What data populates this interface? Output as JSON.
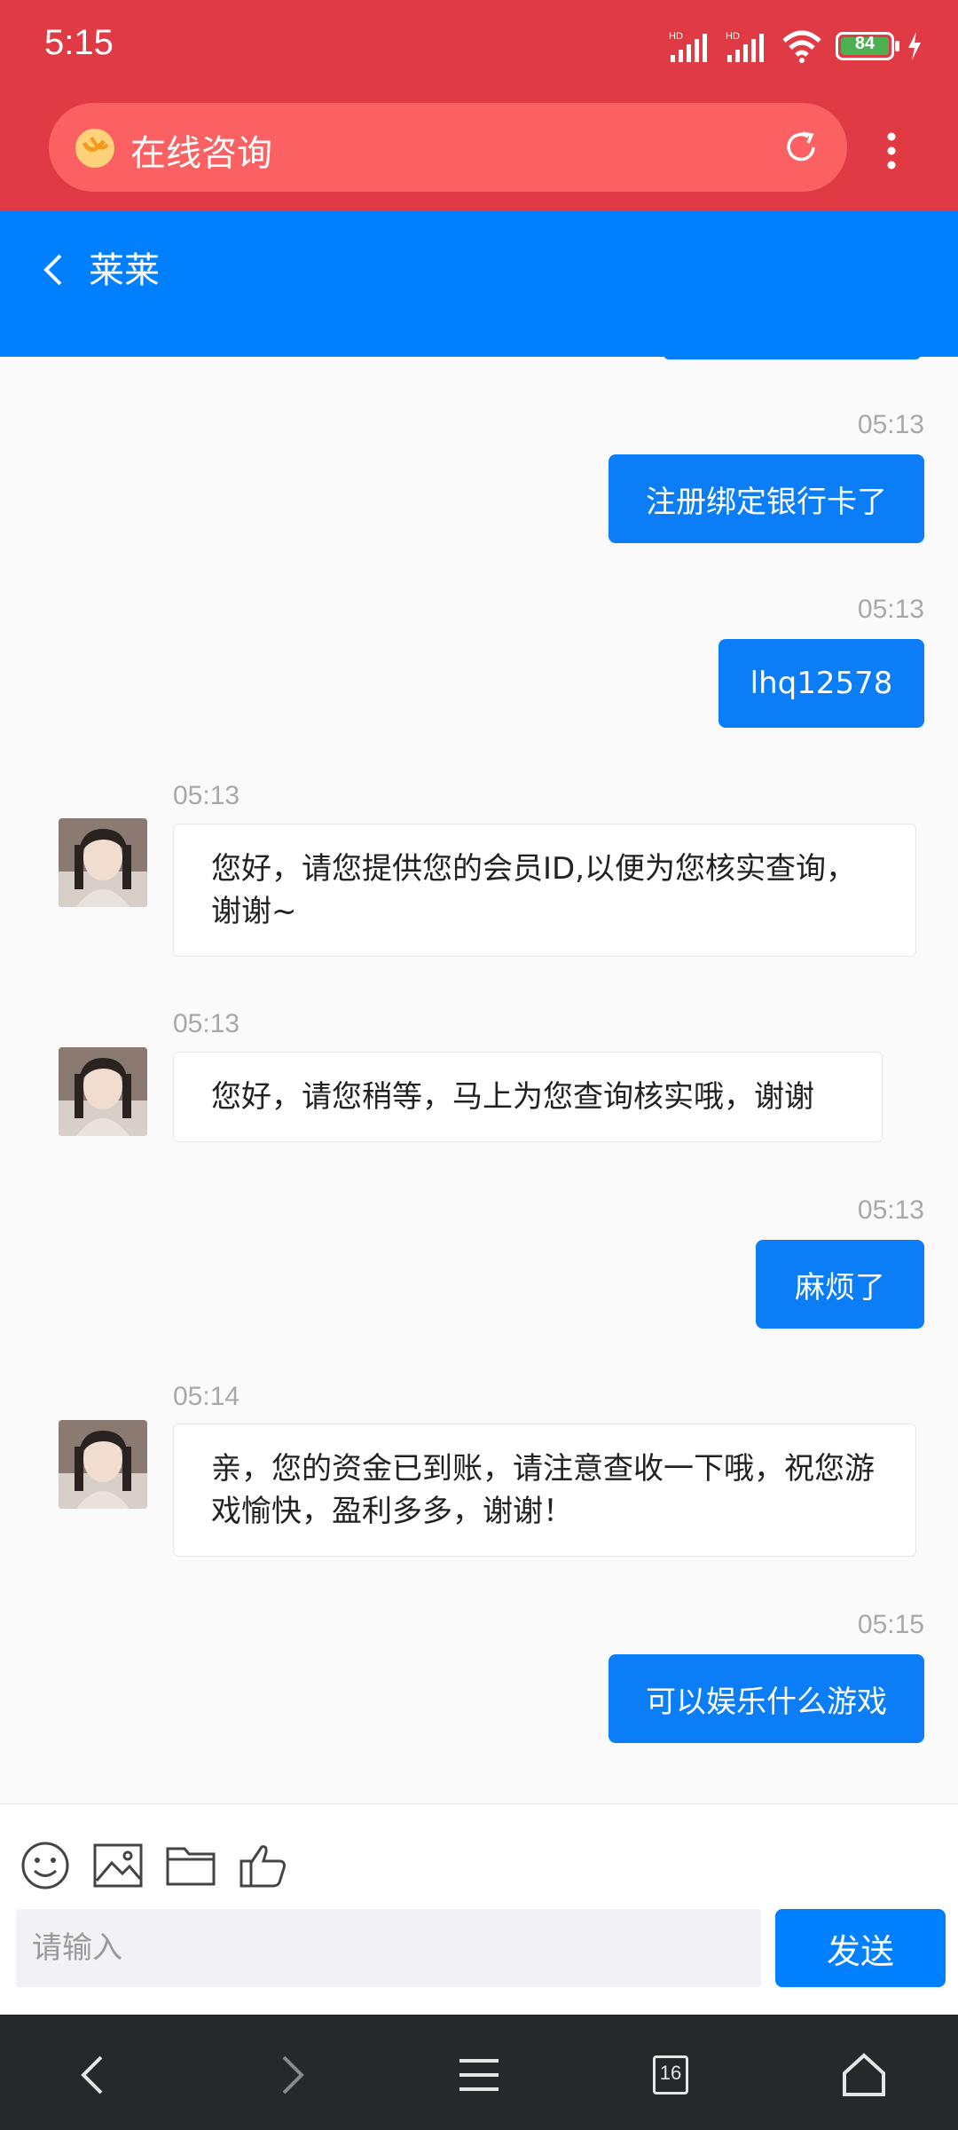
{
  "status_bar": {
    "time": "5:15",
    "battery": "84"
  },
  "browser": {
    "url_title": "在线咨询"
  },
  "chat_header": {
    "title": "莱莱"
  },
  "messages": [
    {
      "direction": "out",
      "time": "05:13",
      "text": "注册绑定银行卡了"
    },
    {
      "direction": "out",
      "time": "05:13",
      "text": "lhq12578"
    },
    {
      "direction": "in",
      "time": "05:13",
      "text": "您好，请您提供您的会员ID,以便为您核实查询，谢谢~"
    },
    {
      "direction": "in",
      "time": "05:13",
      "text": "您好，请您稍等，马上为您查询核实哦，谢谢"
    },
    {
      "direction": "out",
      "time": "05:13",
      "text": "麻烦了"
    },
    {
      "direction": "in",
      "time": "05:14",
      "text": "亲，您的资金已到账，请注意查收一下哦，祝您游戏愉快，盈利多多，谢谢！"
    },
    {
      "direction": "out",
      "time": "05:15",
      "text": "可以娱乐什么游戏"
    }
  ],
  "input": {
    "placeholder": "请输入",
    "send_label": "发送"
  },
  "nav": {
    "tab_count": "16"
  }
}
